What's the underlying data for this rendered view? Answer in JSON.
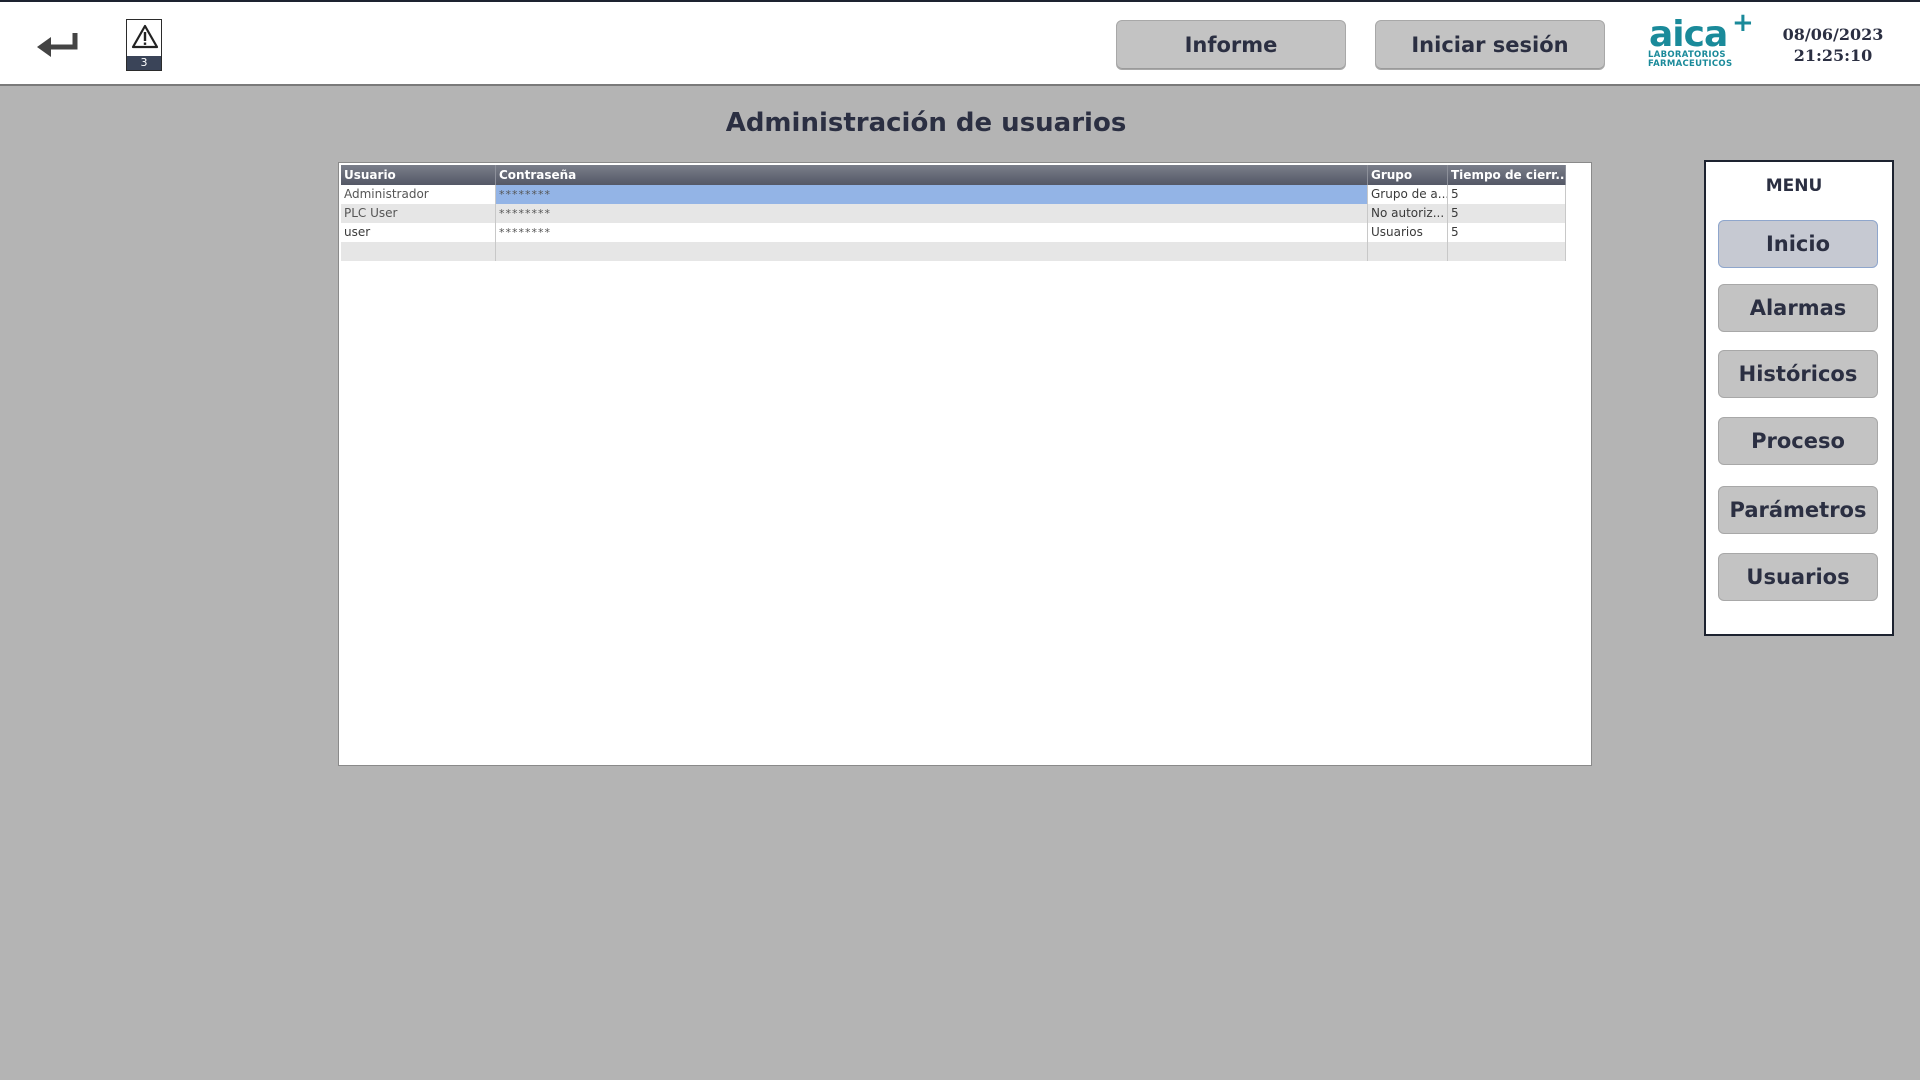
{
  "header": {
    "alarm_count": "3",
    "report_label": "Informe",
    "login_label": "Iniciar sesión",
    "logo": {
      "word": "aica",
      "plus": "+",
      "line1": "LABORATORIOS",
      "line2": "FARMACEUTICOS",
      "color": "#1a8a9a"
    },
    "date": "08/06/2023",
    "time": "21:25:10"
  },
  "page": {
    "title": "Administración de usuarios"
  },
  "users_table": {
    "columns": [
      "Usuario",
      "Contraseña",
      "Grupo",
      "Tiempo de cierr..."
    ],
    "rows": [
      {
        "user": "Administrador",
        "password": "********",
        "group": "Grupo de a...",
        "timeout": "5"
      },
      {
        "user": "PLC User",
        "password": "********",
        "group": "No autoriz...",
        "timeout": "5"
      },
      {
        "user": "user",
        "password": "********",
        "group": "Usuarios",
        "timeout": "5"
      }
    ],
    "selected_color": "#93b4e6"
  },
  "menu": {
    "title": "MENU",
    "items": [
      "Inicio",
      "Alarmas",
      "Históricos",
      "Proceso",
      "Parámetros",
      "Usuarios"
    ]
  },
  "icons": {
    "back": "back-arrow-icon",
    "alarm": "warning-triangle-icon"
  }
}
